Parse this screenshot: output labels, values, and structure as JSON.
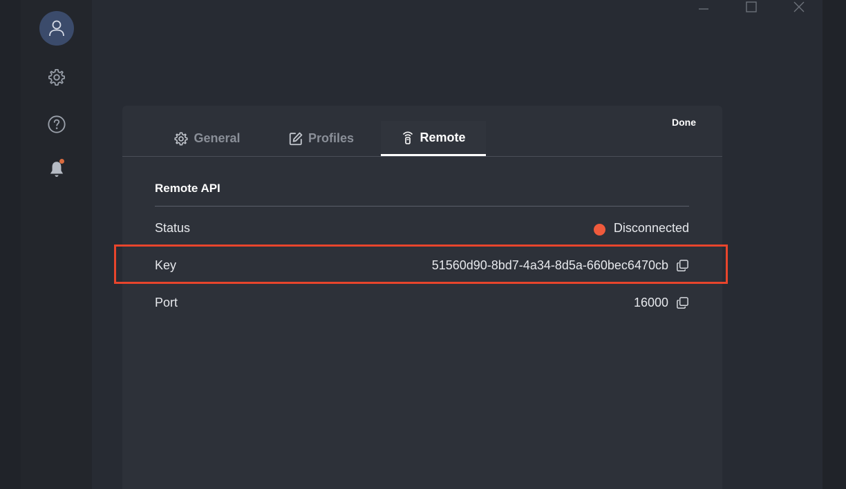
{
  "dialog": {
    "done_label": "Done",
    "tabs": [
      {
        "label": "General",
        "icon": "gear-icon",
        "active": false
      },
      {
        "label": "Profiles",
        "icon": "edit-icon",
        "active": false
      },
      {
        "label": "Remote",
        "icon": "remote-icon",
        "active": true
      }
    ],
    "section_title": "Remote API",
    "rows": {
      "status": {
        "label": "Status",
        "value": "Disconnected",
        "status_color": "#ef5a3c"
      },
      "key": {
        "label": "Key",
        "value": "51560d90-8bd7-4a34-8d5a-660bec6470cb"
      },
      "port": {
        "label": "Port",
        "value": "16000"
      }
    }
  },
  "sidebar": {
    "items": [
      {
        "icon": "user-icon"
      },
      {
        "icon": "gear-icon"
      },
      {
        "icon": "help-icon"
      },
      {
        "icon": "bell-icon",
        "has_notification": true
      }
    ]
  },
  "window_controls": [
    "minimize-icon",
    "maximize-icon",
    "close-icon"
  ],
  "highlight_color": "#e8452c"
}
